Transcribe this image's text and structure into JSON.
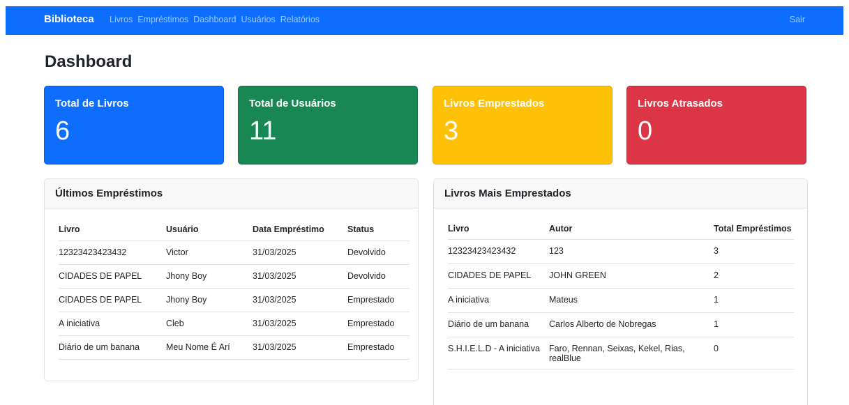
{
  "navbar": {
    "brand": "Biblioteca",
    "links": [
      "Livros",
      "Empréstimos",
      "Dashboard",
      "Usuários",
      "Relatórios"
    ],
    "logout": "Sair",
    "color": "#0d6efd"
  },
  "page": {
    "title": "Dashboard"
  },
  "stats": [
    {
      "title": "Total de Livros",
      "value": "6",
      "color": "#0d6efd"
    },
    {
      "title": "Total de Usuários",
      "value": "11",
      "color": "#198754"
    },
    {
      "title": "Livros Emprestados",
      "value": "3",
      "color": "#ffc107"
    },
    {
      "title": "Livros Atrasados",
      "value": "0",
      "color": "#dc3545"
    }
  ],
  "recent_loans": {
    "title": "Últimos Empréstimos",
    "columns": [
      "Livro",
      "Usuário",
      "Data Empréstimo",
      "Status"
    ],
    "rows": [
      [
        "12323423423432",
        "Victor",
        "31/03/2025",
        "Devolvido"
      ],
      [
        "CIDADES DE PAPEL",
        "Jhony Boy",
        "31/03/2025",
        "Devolvido"
      ],
      [
        "CIDADES DE PAPEL",
        "Jhony Boy",
        "31/03/2025",
        "Emprestado"
      ],
      [
        "A iniciativa",
        "Cleb",
        "31/03/2025",
        "Emprestado"
      ],
      [
        "Diário de um banana",
        "Meu Nome É Arí",
        "31/03/2025",
        "Emprestado"
      ]
    ]
  },
  "top_books": {
    "title": "Livros Mais Emprestados",
    "columns": [
      "Livro",
      "Autor",
      "Total Empréstimos"
    ],
    "rows": [
      [
        "12323423423432",
        "123",
        "3"
      ],
      [
        "CIDADES DE PAPEL",
        "JOHN GREEN",
        "2"
      ],
      [
        "A iniciativa",
        "Mateus",
        "1"
      ],
      [
        "Diário de um banana",
        "Carlos Alberto de Nobregas",
        "1"
      ],
      [
        "S.H.I.E.L.D - A iniciativa",
        "Faro, Rennan, Seixas, Kekel, Rias, realBlue",
        "0"
      ]
    ]
  }
}
